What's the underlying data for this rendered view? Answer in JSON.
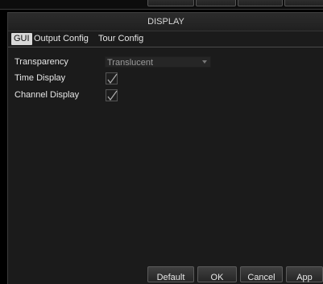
{
  "dialog": {
    "title": "DISPLAY"
  },
  "tabs": [
    {
      "label": "GUI",
      "active": true
    },
    {
      "label": "Output Config",
      "active": false
    },
    {
      "label": "Tour Config",
      "active": false
    }
  ],
  "settings": {
    "transparency": {
      "label": "Transparency",
      "value": "Translucent"
    },
    "time_display": {
      "label": "Time Display",
      "checked": true
    },
    "channel_display": {
      "label": "Channel Display",
      "checked": true
    }
  },
  "buttons": {
    "default": "Default",
    "ok": "OK",
    "cancel": "Cancel",
    "apply": "App"
  },
  "colors": {
    "background": "#000000",
    "dialog_bg": "#1b1b1b",
    "active_tab_bg": "#d9d9d9",
    "text": "#e6e6e6",
    "checkmark": "#b0b0b0"
  }
}
